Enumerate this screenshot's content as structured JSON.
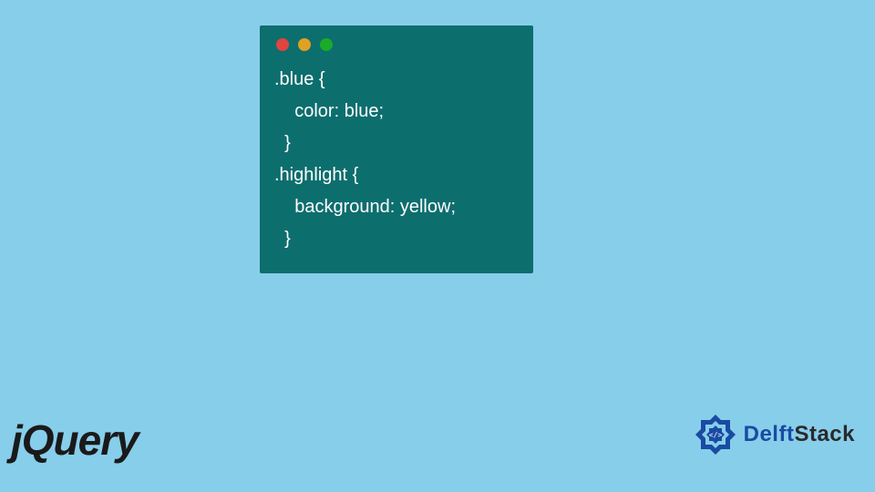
{
  "code": {
    "line1": ".blue {",
    "line2": "    color: blue;",
    "line3": "  }",
    "line4": ".highlight {",
    "line5": "    background: yellow;",
    "line6": "  }"
  },
  "logos": {
    "jquery": "jQuery",
    "delftstack_delft": "Delft",
    "delftstack_stack": "Stack"
  },
  "window_controls": {
    "red": "close",
    "yellow": "minimize",
    "green": "maximize"
  }
}
